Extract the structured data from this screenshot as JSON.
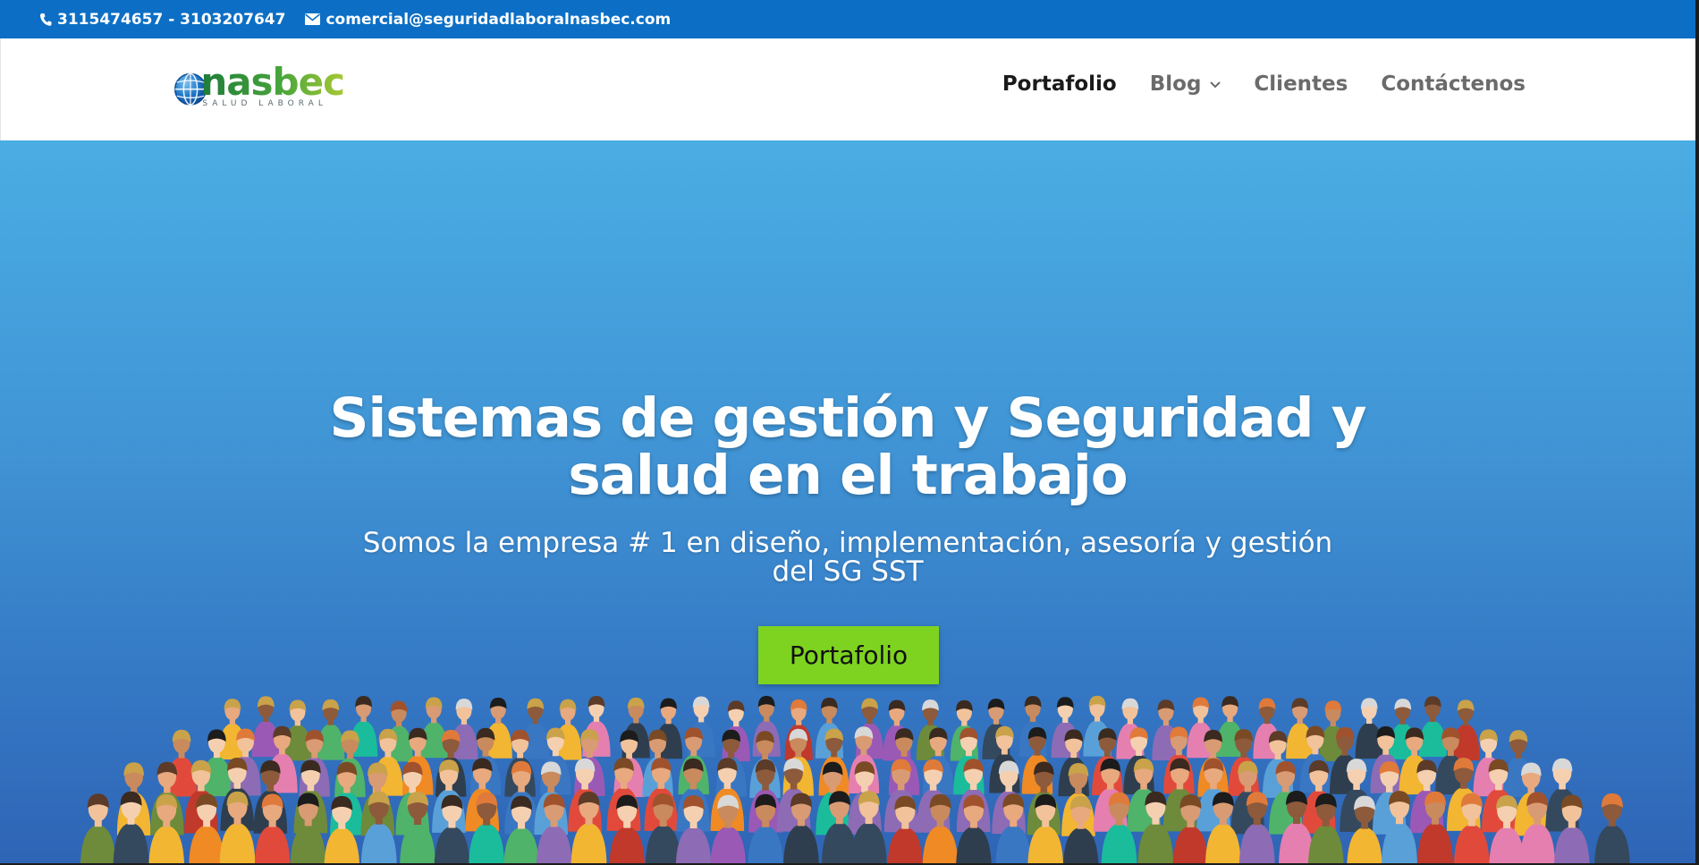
{
  "topbar": {
    "phone": "3115474657 - 3103207647",
    "email": "comercial@seguridadlaboralnasbec.com",
    "phone_icon": "phone-icon",
    "email_icon": "envelope-icon"
  },
  "logo": {
    "brand": "nasbec",
    "tagline": "SALUD LABORAL"
  },
  "nav": {
    "items": [
      {
        "label": "Portafolio",
        "active": true
      },
      {
        "label": "Blog",
        "has_dropdown": true
      },
      {
        "label": "Clientes"
      },
      {
        "label": "Contáctenos"
      }
    ]
  },
  "hero": {
    "title": "Sistemas de gestión y Seguridad y salud en el trabajo",
    "subtitle": "Somos la empresa # 1 en diseño, implementación, asesoría y gestión del SG SST",
    "cta_label": "Portafolio"
  },
  "colors": {
    "topbar": "#0c6fc5",
    "hero_top": "#4aade3",
    "hero_bottom": "#2f64b5",
    "cta": "#7ed321"
  }
}
